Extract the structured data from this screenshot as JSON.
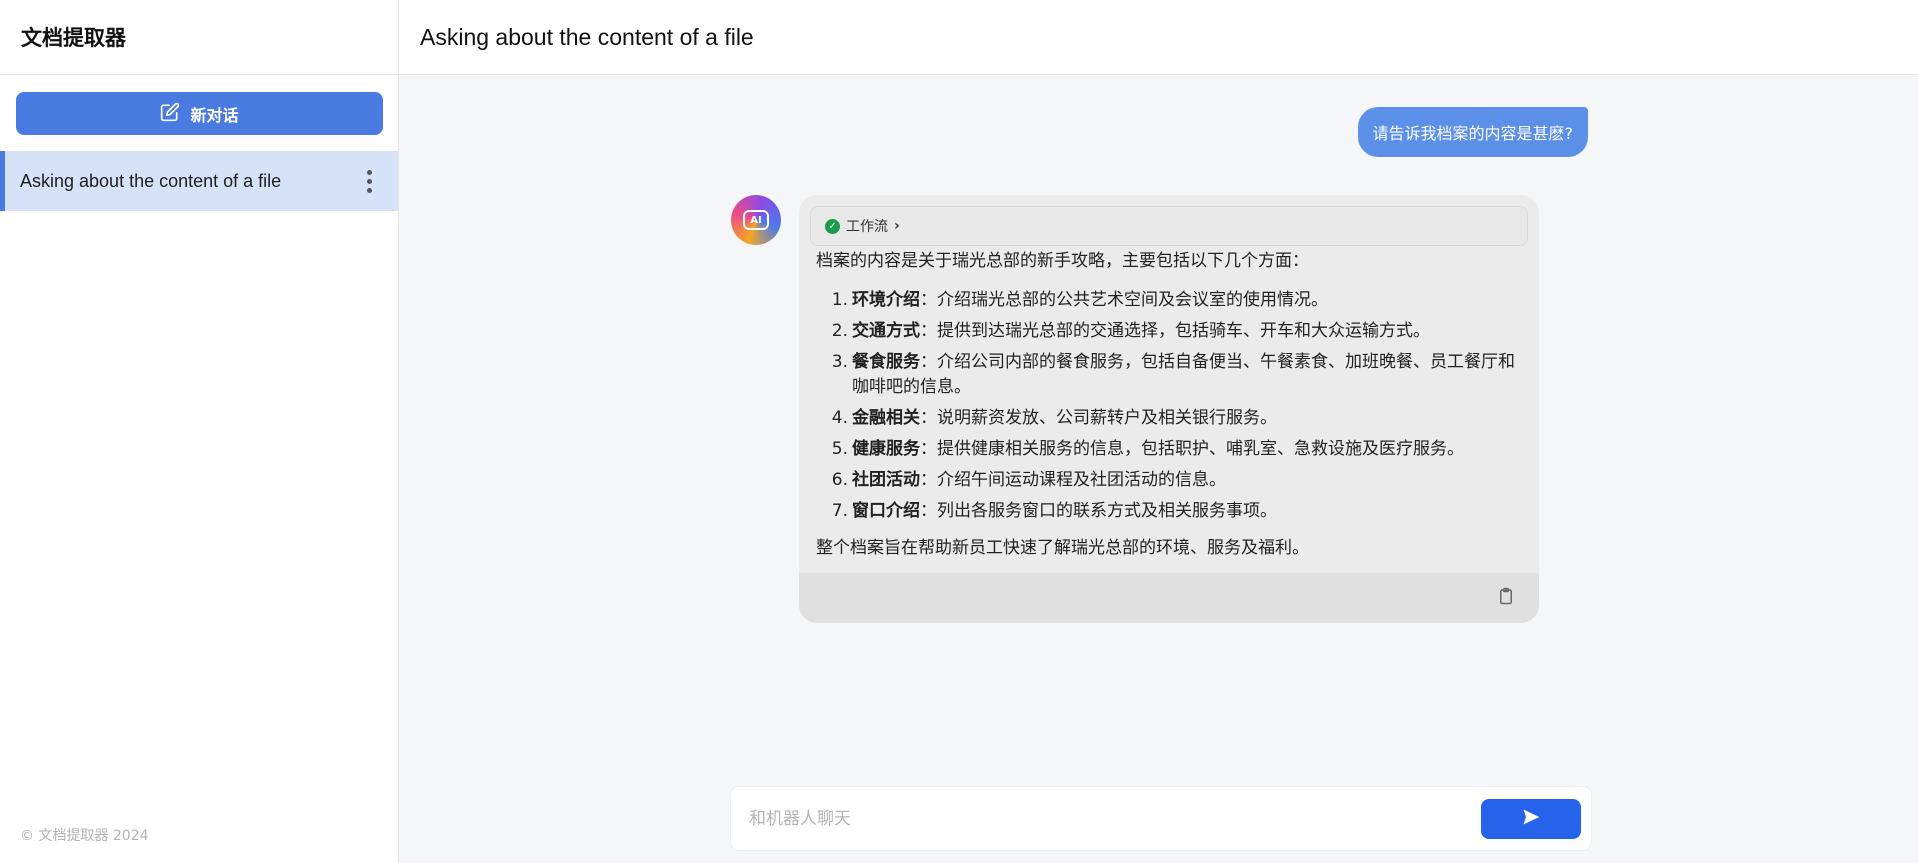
{
  "sidebar": {
    "app_title": "文档提取器",
    "new_chat_label": "新对话",
    "conversations": [
      {
        "title": "Asking about the content of a file",
        "active": true
      }
    ],
    "footer": "© 文档提取器 2024"
  },
  "main": {
    "title": "Asking about the content of a file",
    "messages": {
      "user": "请告诉我档案的内容是甚麽?",
      "bot": {
        "workflow_label": "工作流",
        "intro": "档案的内容是关于瑞光总部的新手攻略，主要包括以下几个方面：",
        "items": [
          {
            "num": "1.",
            "term": "环境介绍",
            "text": "：介绍瑞光总部的公共艺术空间及会议室的使用情况。"
          },
          {
            "num": "2.",
            "term": "交通方式",
            "text": "：提供到达瑞光总部的交通选择，包括骑车、开车和大众运输方式。"
          },
          {
            "num": "3.",
            "term": "餐食服务",
            "text": "：介绍公司内部的餐食服务，包括自备便当、午餐素食、加班晚餐、员工餐厅和咖啡吧的信息。"
          },
          {
            "num": "4.",
            "term": "金融相关",
            "text": "：说明薪资发放、公司薪转户及相关银行服务。"
          },
          {
            "num": "5.",
            "term": "健康服务",
            "text": "：提供健康相关服务的信息，包括职护、哺乳室、急救设施及医疗服务。"
          },
          {
            "num": "6.",
            "term": "社团活动",
            "text": "：介绍午间运动课程及社团活动的信息。"
          },
          {
            "num": "7.",
            "term": "窗口介绍",
            "text": "：列出各服务窗口的联系方式及相关服务事项。"
          }
        ],
        "summary": "整个档案旨在帮助新员工快速了解瑞光总部的环境、服务及福利。"
      }
    },
    "input": {
      "placeholder": "和机器人聊天",
      "value": ""
    }
  },
  "colors": {
    "accent": "#4a7be0",
    "user_bubble": "#5c8fe8",
    "send_button": "#2563eb",
    "active_item_bg": "#d6e2f7"
  },
  "icons": {
    "new_chat": "edit-icon",
    "more": "kebab-icon",
    "workflow_status": "check-circle-icon",
    "expand": "chevron-right-icon",
    "copy": "clipboard-icon",
    "send": "send-icon",
    "bot_avatar": "ai-bot-icon"
  }
}
